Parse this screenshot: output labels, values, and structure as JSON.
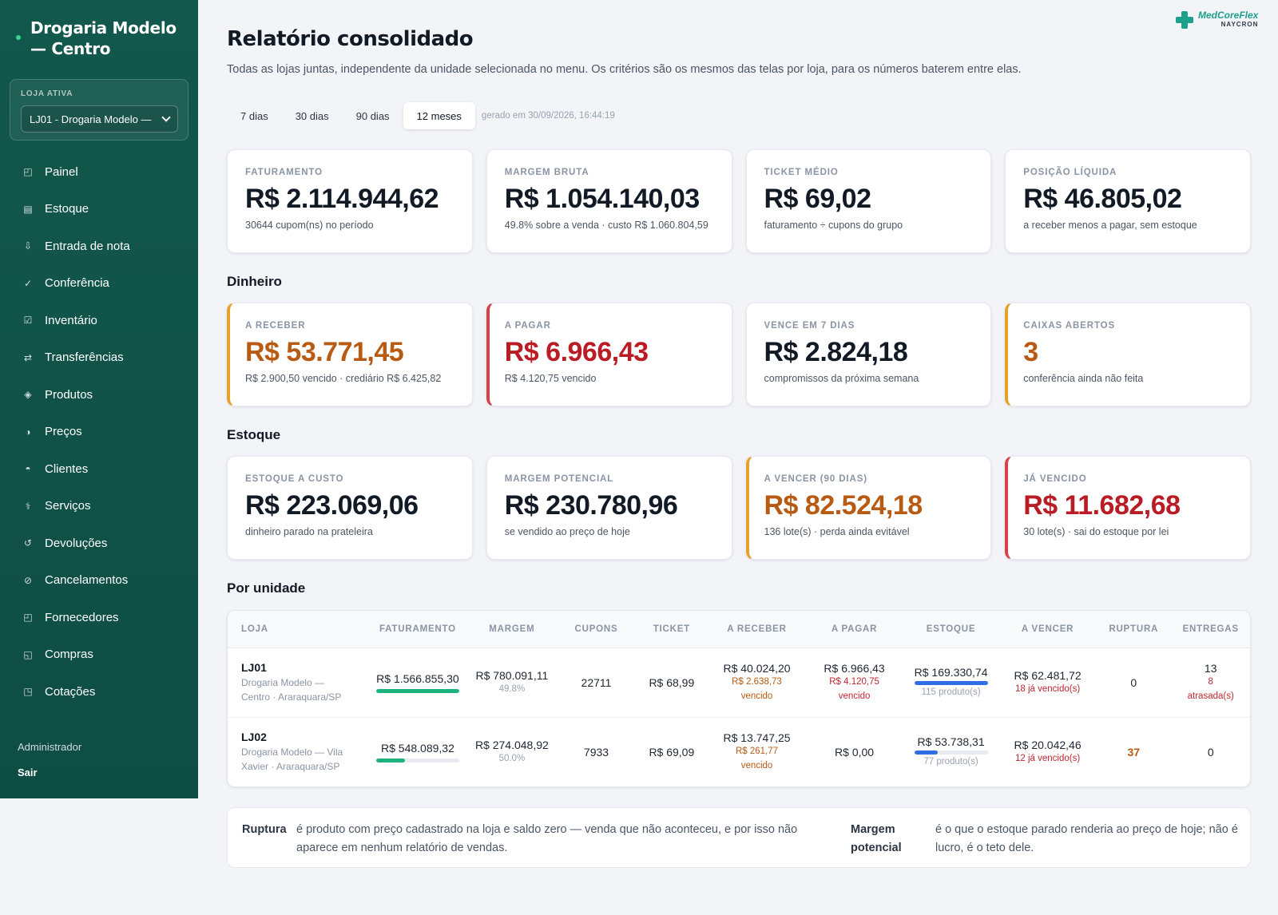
{
  "sidebar": {
    "brand": "Drogaria Modelo — Centro",
    "store_box_label": "LOJA ATIVA",
    "store_selected": "LJ01 - Drogaria Modelo —",
    "items": [
      {
        "label": "Painel",
        "icon": "◰"
      },
      {
        "label": "Estoque",
        "icon": "▤"
      },
      {
        "label": "Entrada de nota",
        "icon": "⇩"
      },
      {
        "label": "Conferência",
        "icon": "✓"
      },
      {
        "label": "Inventário",
        "icon": "☑"
      },
      {
        "label": "Transferências",
        "icon": "⇄"
      },
      {
        "label": "Produtos",
        "icon": "◈"
      },
      {
        "label": "Preços",
        "icon": "◑"
      },
      {
        "label": "Clientes",
        "icon": "◓"
      },
      {
        "label": "Serviços",
        "icon": "⚕"
      },
      {
        "label": "Devoluções",
        "icon": "↺"
      },
      {
        "label": "Cancelamentos",
        "icon": "⊘"
      },
      {
        "label": "Fornecedores",
        "icon": "◰"
      },
      {
        "label": "Compras",
        "icon": "◱"
      },
      {
        "label": "Cotações",
        "icon": "◳"
      }
    ],
    "user": "Administrador",
    "logout": "Sair"
  },
  "logo": {
    "name": "MedCoreFlex",
    "sub": "NAYCRON"
  },
  "header": {
    "title": "Relatório consolidado",
    "subtitle": "Todas as lojas juntas, independente da unidade selecionada no menu. Os critérios são os mesmos das telas por loja, para os números baterem entre elas."
  },
  "tabs": [
    "7 dias",
    "30 dias",
    "90 dias",
    "12 meses"
  ],
  "active_tab": "12 meses",
  "generated": "gerado em 30/09/2026, 16:44:19",
  "summary": [
    {
      "label": "FATURAMENTO",
      "value": "R$ 2.114.944,62",
      "note": "30644 cupom(ns) no período"
    },
    {
      "label": "MARGEM BRUTA",
      "value": "R$ 1.054.140,03",
      "note": "49.8% sobre a venda · custo R$ 1.060.804,59"
    },
    {
      "label": "TICKET MÉDIO",
      "value": "R$ 69,02",
      "note": "faturamento ÷ cupons do grupo"
    },
    {
      "label": "POSIÇÃO LÍQUIDA",
      "value": "R$ 46.805,02",
      "note": "a receber menos a pagar, sem estoque"
    }
  ],
  "sections": {
    "money": "Dinheiro",
    "stock": "Estoque",
    "units": "Por unidade"
  },
  "money": [
    {
      "label": "A RECEBER",
      "value": "R$ 53.771,45",
      "note": "R$ 2.900,50 vencido · crediário R$ 6.425,82"
    },
    {
      "label": "A PAGAR",
      "value": "R$ 6.966,43",
      "note": "R$ 4.120,75 vencido"
    },
    {
      "label": "VENCE EM 7 DIAS",
      "value": "R$ 2.824,18",
      "note": "compromissos da próxima semana"
    },
    {
      "label": "CAIXAS ABERTOS",
      "value": "3",
      "note": "conferência ainda não feita"
    }
  ],
  "stock": [
    {
      "label": "ESTOQUE A CUSTO",
      "value": "R$ 223.069,06",
      "note": "dinheiro parado na prateleira"
    },
    {
      "label": "MARGEM POTENCIAL",
      "value": "R$ 230.780,96",
      "note": "se vendido ao preço de hoje"
    },
    {
      "label": "A VENCER (90 DIAS)",
      "value": "R$ 82.524,18",
      "note": "136 lote(s) · perda ainda evitável"
    },
    {
      "label": "JÁ VENCIDO",
      "value": "R$ 11.682,68",
      "note": "30 lote(s) · sai do estoque por lei"
    }
  ],
  "table": {
    "headers": [
      "LOJA",
      "FATURAMENTO",
      "MARGEM",
      "CUPONS",
      "TICKET",
      "A RECEBER",
      "A PAGAR",
      "ESTOQUE",
      "A VENCER",
      "RUPTURA",
      "ENTREGAS"
    ],
    "rows": [
      {
        "code": "LJ01",
        "name": "Drogaria Modelo — Centro · Araraquara/SP",
        "revenue": "R$ 1.566.855,30",
        "revenue_share": 1.0,
        "margin": "R$ 780.091,11",
        "margin_pct": "49.8%",
        "coupons": "22711",
        "ticket": "R$ 68,99",
        "receivable": "R$ 40.024,20",
        "receivable_overdue": "R$ 2.638,73",
        "receivable_overdue_label": "vencido",
        "payable": "R$ 6.966,43",
        "payable_overdue": "R$ 4.120,75",
        "payable_overdue_label": "vencido",
        "stock": "R$ 169.330,74",
        "stock_share": 1.0,
        "stock_products": "115 produto(s)",
        "expiring": "R$ 62.481,72",
        "expired_note": "18 já vencido(s)",
        "rupture": "0",
        "deliveries": "13",
        "deliveries_late": "8 atrasada(s)"
      },
      {
        "code": "LJ02",
        "name": "Drogaria Modelo — Vila Xavier · Araraquara/SP",
        "revenue": "R$ 548.089,32",
        "revenue_share": 0.35,
        "margin": "R$ 274.048,92",
        "margin_pct": "50.0%",
        "coupons": "7933",
        "ticket": "R$ 69,09",
        "receivable": "R$ 13.747,25",
        "receivable_overdue": "R$ 261,77",
        "receivable_overdue_label": "vencido",
        "payable": "R$ 0,00",
        "stock": "R$ 53.738,31",
        "stock_share": 0.32,
        "stock_products": "77 produto(s)",
        "expiring": "R$ 20.042,46",
        "expired_note": "12 já vencido(s)",
        "rupture": "37",
        "deliveries": "0"
      }
    ]
  },
  "legend": [
    {
      "term": "Ruptura",
      "text": "é produto com preço cadastrado na loja e saldo zero — venda que não aconteceu, e por isso não aparece em nenhum relatório de vendas."
    },
    {
      "term": "Margem potencial",
      "text": "é o que o estoque parado renderia ao preço de hoje; não é lucro, é o teto dele."
    }
  ],
  "colors": {
    "sidebar": "#13584c",
    "accent_green": "#1db27c",
    "bar_blue": "#2f6fe4",
    "warn": "#e6a22c",
    "danger": "#d9414a",
    "orange_text": "#b85a12",
    "red_text": "#b91c24"
  }
}
